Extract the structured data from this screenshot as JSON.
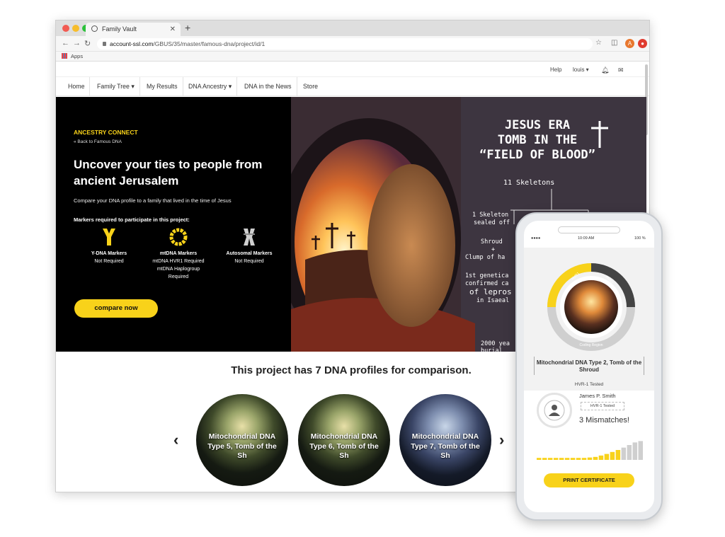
{
  "browser": {
    "tab_title": "Family Vault",
    "url_host": "account-ssl.com",
    "url_path": "/GBUS/35/master/famous-dna/project/id/1",
    "bookmarks_label": "Apps",
    "avatar_letter": "A"
  },
  "topbar": {
    "help": "Help",
    "user": "louis ▾"
  },
  "nav": [
    {
      "label": "Home"
    },
    {
      "label": "Family Tree ▾"
    },
    {
      "label": "My Results"
    },
    {
      "label": "DNA Ancestry ▾"
    },
    {
      "label": "DNA in the News"
    },
    {
      "label": "Store"
    }
  ],
  "hero": {
    "eyebrow": "ANCESTRY CONNECT",
    "back_link": "« Back to Famous DNA",
    "title": "Uncover your ties to people from ancient Jerusalem",
    "subtitle": "Compare your DNA profile to a family that lived in the time of Jesus",
    "markers_heading": "Markers required to participate in this project:",
    "markers": [
      {
        "title": "Y-DNA Markers",
        "lines": [
          "Not Required"
        ],
        "icon": "y-dna-icon"
      },
      {
        "title": "mtDNA Markers",
        "lines": [
          "mtDNA HVR1 Required",
          "mtDNA Haplogroup Required"
        ],
        "icon": "mtdna-ring-icon"
      },
      {
        "title": "Autosomal Markers",
        "lines": [
          "Not Required"
        ],
        "icon": "chromosome-icon"
      }
    ],
    "cta": "compare now"
  },
  "infographic": {
    "title_lines": [
      "JESUS ERA",
      "TOMB IN THE",
      "“FIELD OF BLOOD”"
    ],
    "skeletons": "11 Skeletons",
    "notes": [
      "1 Skeleton",
      "sealed off",
      "Shroud",
      "+",
      "Clump of ha",
      "1st genetica",
      "confirmed ca",
      "of lepros",
      "in Isaeal",
      "2000 yea",
      "burial"
    ]
  },
  "profiles": {
    "heading": "This project has 7 DNA profiles for comparison.",
    "items": [
      {
        "label": "Mitochondrial DNA Type 5, Tomb of the Sh"
      },
      {
        "label": "Mitochondrial DNA Type 6, Tomb of the Sh"
      },
      {
        "label": "Mitochondrial DNA Type 7, Tomb of the Sh"
      }
    ],
    "prev": "‹",
    "next": "›"
  },
  "phone": {
    "time": "10:09 AM",
    "battery": "100 %",
    "ring_labels": [
      "HVR1",
      "HVR2"
    ],
    "ring_bottom": "Coding Region",
    "profile_title": "Mitochondrial DNA Type 2, Tomb of the Shroud",
    "profile_tested": "HVR-1 Tested",
    "user_name": "James P. Smith",
    "user_tested": "HVR-1 Tested",
    "mismatches": "3 Mismatches!",
    "bars": [
      0.1,
      0.1,
      0.1,
      0.1,
      0.1,
      0.1,
      0.1,
      0.1,
      0.1,
      0.12,
      0.15,
      0.22,
      0.3,
      0.4,
      0.5,
      0.62,
      0.75,
      0.88,
      0.95
    ],
    "print_button": "PRINT CERTIFICATE"
  },
  "colors": {
    "accent": "#f8d21a",
    "hero_bg": "#000000"
  }
}
